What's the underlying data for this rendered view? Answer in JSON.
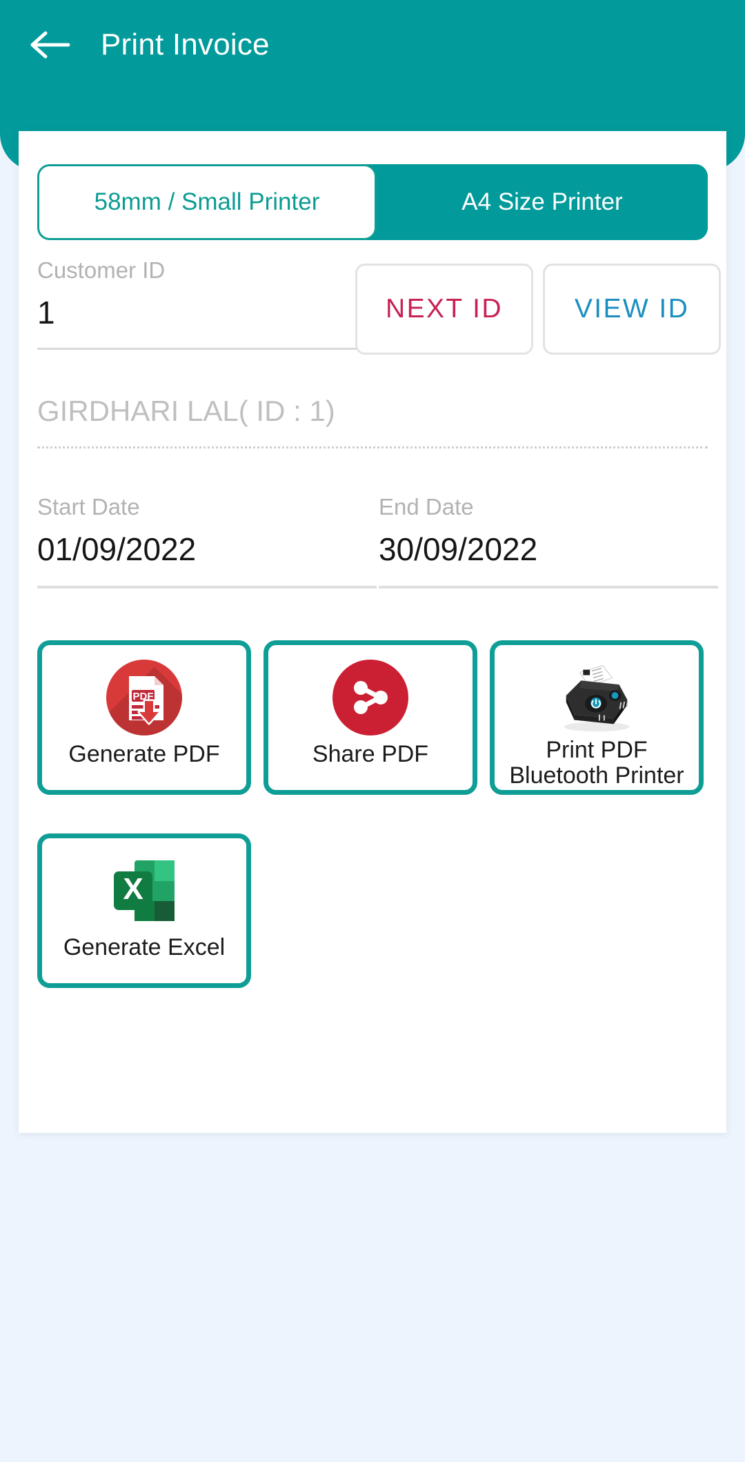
{
  "header": {
    "title": "Print Invoice",
    "back_icon": "arrow-left-icon",
    "background_color": "#029a9a"
  },
  "printer_tabs": {
    "small_printer": "58mm / Small Printer",
    "a4_printer": "A4 Size Printer",
    "selected": "58mm / Small Printer",
    "selected_text_color": "#0c9b92",
    "unselected_text_color": "#ffffff"
  },
  "customer": {
    "id_label": "Customer ID",
    "id_value": "1",
    "next_id_label": "NEXT ID",
    "next_id_color": "#c72253",
    "view_id_label": "VIEW ID",
    "view_id_color": "#1a8ec0",
    "name_display": "GIRDHARI LAL( ID : 1)"
  },
  "date_range": {
    "start_label": "Start Date",
    "start_value": "01/09/2022",
    "end_label": "End Date",
    "end_value": "30/09/2022"
  },
  "actions": {
    "generate_pdf": {
      "label": "Generate PDF",
      "icon": "pdf-download-icon",
      "icon_color": "#d83a3a"
    },
    "share_pdf": {
      "label": "Share PDF",
      "icon": "share-icon",
      "icon_color": "#cb2033"
    },
    "print_pdf": {
      "label": "Print PDF\nBluetooth Printer",
      "icon": "bluetooth-printer-icon",
      "icon_color": "#2b2b2b"
    },
    "generate_excel": {
      "label": "Generate Excel",
      "icon": "excel-icon",
      "icon_color": "#1e7145"
    },
    "card_border_color": "#0e9e95"
  }
}
